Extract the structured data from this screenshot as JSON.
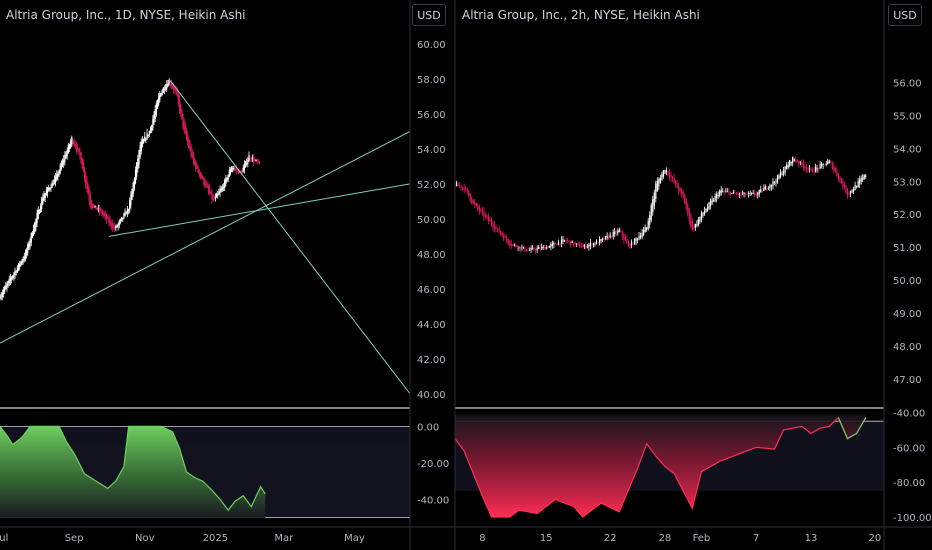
{
  "currency_label": "USD",
  "chart_data": [
    {
      "type": "candlestick",
      "title": "Altria Group, Inc., 1D, NYSE, Heikin Ashi",
      "ylim": [
        39.3,
        60.8
      ],
      "y_ticks": [
        "60.00",
        "58.00",
        "56.00",
        "54.00",
        "52.00",
        "50.00",
        "48.00",
        "46.00",
        "44.00",
        "42.00",
        "40.00"
      ],
      "x_ticks": [
        "Jul",
        "Sep",
        "Nov",
        "2025",
        "Mar",
        "May"
      ],
      "x_ticks_dates": [
        "2024-07-01",
        "2024-09-01",
        "2024-11-01",
        "2025-01-01",
        "2025-03-01",
        "2025-05-01"
      ],
      "x_range": [
        "2024-06-29",
        "2025-06-18"
      ],
      "price_path": [
        {
          "date": "2024-06-29",
          "close": 45.6
        },
        {
          "date": "2024-07-21",
          "close": 48.0
        },
        {
          "date": "2024-08-05",
          "close": 51.3
        },
        {
          "date": "2024-08-16",
          "close": 52.3
        },
        {
          "date": "2024-08-30",
          "close": 54.6
        },
        {
          "date": "2024-09-06",
          "close": 53.6
        },
        {
          "date": "2024-09-15",
          "close": 50.8
        },
        {
          "date": "2024-09-24",
          "close": 50.4
        },
        {
          "date": "2024-10-06",
          "close": 49.4
        },
        {
          "date": "2024-10-18",
          "close": 50.6
        },
        {
          "date": "2024-10-28",
          "close": 54.2
        },
        {
          "date": "2024-11-05",
          "close": 55.0
        },
        {
          "date": "2024-11-14",
          "close": 57.2
        },
        {
          "date": "2024-11-22",
          "close": 57.9
        },
        {
          "date": "2024-11-28",
          "close": 57.2
        },
        {
          "date": "2024-12-05",
          "close": 55.0
        },
        {
          "date": "2024-12-13",
          "close": 53.2
        },
        {
          "date": "2024-12-25",
          "close": 51.7
        },
        {
          "date": "2024-12-30",
          "close": 51.0
        },
        {
          "date": "2025-01-07",
          "close": 51.8
        },
        {
          "date": "2025-01-15",
          "close": 53.0
        },
        {
          "date": "2025-01-23",
          "close": 52.6
        },
        {
          "date": "2025-01-30",
          "close": 53.6
        },
        {
          "date": "2025-02-08",
          "close": 53.1
        }
      ],
      "trendlines": [
        {
          "from": {
            "date": "2024-06-29",
            "value": 42.9
          },
          "to": {
            "date": "2025-06-18",
            "value": 55.0
          }
        },
        {
          "from": {
            "date": "2024-10-01",
            "value": 49.0
          },
          "to": {
            "date": "2025-06-18",
            "value": 52.0
          }
        },
        {
          "from": {
            "date": "2024-11-23",
            "value": 57.9
          },
          "to": {
            "date": "2025-06-18",
            "value": 40.0
          }
        }
      ],
      "indicator": {
        "type": "area",
        "ylim": [
          -53.5,
          9.5
        ],
        "y_ticks": [
          "0.00",
          "-20.00",
          "-40.00"
        ],
        "levels": [
          0,
          -50
        ],
        "series": [
          {
            "date": "2024-06-29",
            "value": 0
          },
          {
            "date": "2024-07-05",
            "value": -5
          },
          {
            "date": "2024-07-10",
            "value": -10
          },
          {
            "date": "2024-07-18",
            "value": -6
          },
          {
            "date": "2024-07-25",
            "value": 0
          },
          {
            "date": "2024-08-19",
            "value": 0
          },
          {
            "date": "2024-08-25",
            "value": -8
          },
          {
            "date": "2024-09-02",
            "value": -16
          },
          {
            "date": "2024-09-10",
            "value": -26
          },
          {
            "date": "2024-09-20",
            "value": -30
          },
          {
            "date": "2024-09-30",
            "value": -34
          },
          {
            "date": "2024-10-07",
            "value": -30
          },
          {
            "date": "2024-10-14",
            "value": -22
          },
          {
            "date": "2024-10-18",
            "value": 0
          },
          {
            "date": "2024-11-15",
            "value": 0
          },
          {
            "date": "2024-11-25",
            "value": -3
          },
          {
            "date": "2024-12-01",
            "value": -12
          },
          {
            "date": "2024-12-07",
            "value": -25
          },
          {
            "date": "2024-12-14",
            "value": -28
          },
          {
            "date": "2024-12-21",
            "value": -30
          },
          {
            "date": "2024-12-29",
            "value": -35
          },
          {
            "date": "2025-01-05",
            "value": -40
          },
          {
            "date": "2025-01-12",
            "value": -46
          },
          {
            "date": "2025-01-18",
            "value": -41
          },
          {
            "date": "2025-01-25",
            "value": -38
          },
          {
            "date": "2025-02-01",
            "value": -44
          },
          {
            "date": "2025-02-09",
            "value": -33
          },
          {
            "date": "2025-02-13",
            "value": -37
          }
        ]
      }
    },
    {
      "type": "candlestick",
      "title": "Altria Group, Inc., 2h, NYSE, Heikin Ashi",
      "ylim": [
        46.6,
        57.05
      ],
      "y_ticks": [
        "56.00",
        "55.00",
        "54.00",
        "53.00",
        "52.00",
        "51.00",
        "50.00",
        "49.00",
        "48.00",
        "47.00"
      ],
      "x_ticks": [
        "8",
        "15",
        "22",
        "28",
        "Feb",
        "7",
        "13",
        "20"
      ],
      "x_ticks_dates": [
        "2025-01-08",
        "2025-01-15",
        "2025-01-22",
        "2025-01-28",
        "2025-02-01",
        "2025-02-07",
        "2025-02-13",
        "2025-02-20"
      ],
      "x_range": [
        "2025-01-05",
        "2025-02-21"
      ],
      "price_path": [
        {
          "date": "2025-01-05",
          "close": 52.9
        },
        {
          "date": "2025-01-06",
          "close": 52.8
        },
        {
          "date": "2025-01-07",
          "close": 52.3
        },
        {
          "date": "2025-01-09",
          "close": 51.7
        },
        {
          "date": "2025-01-11",
          "close": 51.1
        },
        {
          "date": "2025-01-13",
          "close": 50.9
        },
        {
          "date": "2025-01-15",
          "close": 51.0
        },
        {
          "date": "2025-01-17",
          "close": 51.2
        },
        {
          "date": "2025-01-19",
          "close": 51.0
        },
        {
          "date": "2025-01-21",
          "close": 51.2
        },
        {
          "date": "2025-01-23",
          "close": 51.5
        },
        {
          "date": "2025-01-24",
          "close": 51.0
        },
        {
          "date": "2025-01-26",
          "close": 51.6
        },
        {
          "date": "2025-01-27",
          "close": 52.9
        },
        {
          "date": "2025-01-28",
          "close": 53.4
        },
        {
          "date": "2025-01-30",
          "close": 52.5
        },
        {
          "date": "2025-01-31",
          "close": 51.5
        },
        {
          "date": "2025-02-01",
          "close": 52.0
        },
        {
          "date": "2025-02-03",
          "close": 52.7
        },
        {
          "date": "2025-02-05",
          "close": 52.6
        },
        {
          "date": "2025-02-07",
          "close": 52.6
        },
        {
          "date": "2025-02-09",
          "close": 53.0
        },
        {
          "date": "2025-02-11",
          "close": 53.7
        },
        {
          "date": "2025-02-13",
          "close": 53.3
        },
        {
          "date": "2025-02-15",
          "close": 53.6
        },
        {
          "date": "2025-02-17",
          "close": 52.6
        },
        {
          "date": "2025-02-19",
          "close": 53.2
        }
      ],
      "indicator": {
        "type": "area",
        "ylim": [
          -104,
          -38
        ],
        "y_ticks": [
          "-40.00",
          "-60.00",
          "-80.00",
          "-100.00"
        ],
        "levels": [
          -45
        ],
        "series": [
          {
            "date": "2025-01-05",
            "value": -55
          },
          {
            "date": "2025-01-06",
            "value": -62
          },
          {
            "date": "2025-01-08",
            "value": -88
          },
          {
            "date": "2025-01-09",
            "value": -100
          },
          {
            "date": "2025-01-11",
            "value": -100
          },
          {
            "date": "2025-01-12",
            "value": -96
          },
          {
            "date": "2025-01-14",
            "value": -98
          },
          {
            "date": "2025-01-16",
            "value": -90
          },
          {
            "date": "2025-01-18",
            "value": -94
          },
          {
            "date": "2025-01-19",
            "value": -100
          },
          {
            "date": "2025-01-21",
            "value": -92
          },
          {
            "date": "2025-01-23",
            "value": -97
          },
          {
            "date": "2025-01-25",
            "value": -72
          },
          {
            "date": "2025-01-26",
            "value": -58
          },
          {
            "date": "2025-01-27",
            "value": -65
          },
          {
            "date": "2025-01-28",
            "value": -71
          },
          {
            "date": "2025-01-29",
            "value": -75
          },
          {
            "date": "2025-01-31",
            "value": -95
          },
          {
            "date": "2025-02-01",
            "value": -74
          },
          {
            "date": "2025-02-03",
            "value": -68
          },
          {
            "date": "2025-02-05",
            "value": -64
          },
          {
            "date": "2025-02-07",
            "value": -60
          },
          {
            "date": "2025-02-09",
            "value": -61
          },
          {
            "date": "2025-02-10",
            "value": -50
          },
          {
            "date": "2025-02-12",
            "value": -48
          },
          {
            "date": "2025-02-13",
            "value": -52
          },
          {
            "date": "2025-02-14",
            "value": -49
          },
          {
            "date": "2025-02-15",
            "value": -48
          },
          {
            "date": "2025-02-16",
            "value": -43
          },
          {
            "date": "2025-02-17",
            "value": -55
          },
          {
            "date": "2025-02-18",
            "value": -52
          },
          {
            "date": "2025-02-19",
            "value": -43
          }
        ]
      }
    }
  ],
  "colors": {
    "background": "#000000",
    "up_candle": "#ffffff",
    "down_candle": "#d81b5c",
    "trendline": "#7fd1c0",
    "indicator_green": "#6fcf5f",
    "indicator_red": "#ff2e55",
    "axis_text": "#b2b5be",
    "separator": "#ffffff"
  }
}
